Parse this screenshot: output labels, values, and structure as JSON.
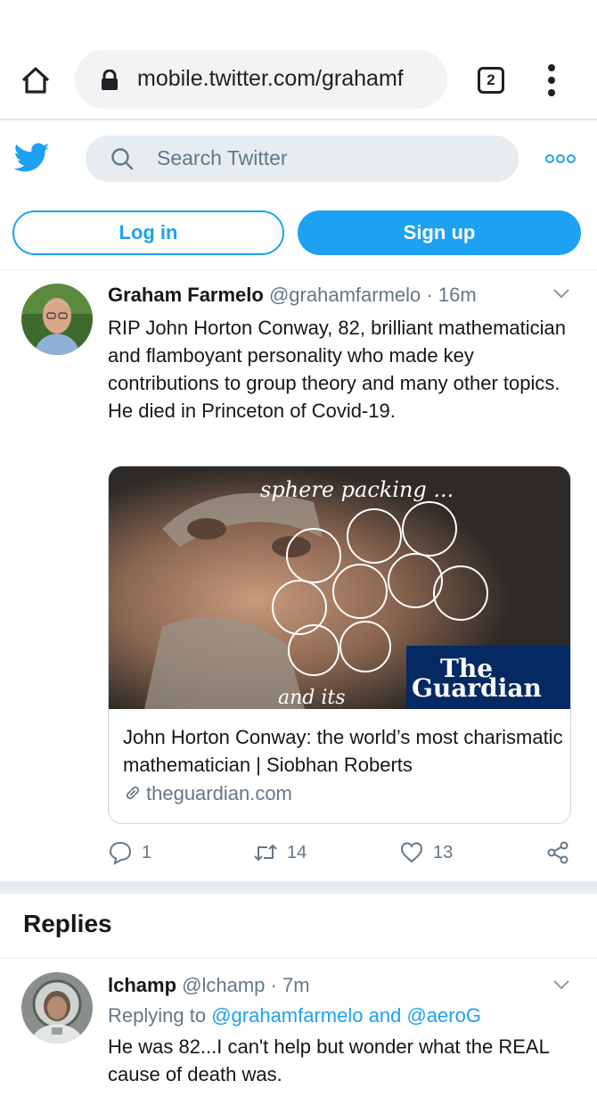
{
  "browser": {
    "url": "mobile.twitter.com/grahamf",
    "tab_count": "2",
    "icons": {
      "home": "home-icon",
      "lock": "lock-icon",
      "menu": "vertical-dots-icon"
    }
  },
  "header": {
    "search_placeholder": "Search Twitter",
    "login_label": "Log in",
    "signup_label": "Sign up",
    "accent_color": "#1da1f2"
  },
  "tweet": {
    "author_name": "Graham Farmelo",
    "author_handle": "@grahamfarmelo",
    "separator": "·",
    "time": "16m",
    "text": "RIP John Horton Conway, 82, brilliant mathematician and flamboyant personality who made key contributions to group theory and many other topics. He died in Princeton of Covid-19.",
    "card": {
      "image_text_scribble": "sphere packing ...",
      "image_text_bottom": "and its",
      "logo_line1": "The",
      "logo_line2": "Guardian",
      "title": "John Horton Conway: the world’s most charismatic mathematician | Siobhan Roberts",
      "domain": "theguardian.com"
    },
    "actions": {
      "replies": "1",
      "retweets": "14",
      "likes": "13"
    }
  },
  "replies_section": {
    "title": "Replies",
    "items": [
      {
        "author_name": "lchamp",
        "author_handle": "@lchamp",
        "separator": "·",
        "time": "7m",
        "replying_label": "Replying to",
        "mention_1": "@grahamfarmelo",
        "and_label": "and",
        "mention_2": "@aeroG",
        "text": "He was 82...I can't help but wonder what the REAL cause of death was."
      }
    ]
  }
}
